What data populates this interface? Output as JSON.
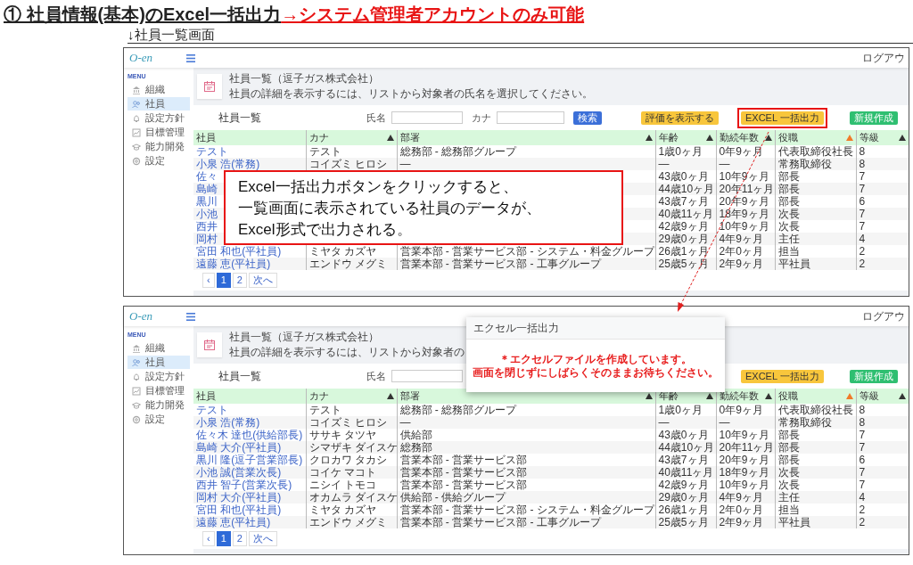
{
  "heading": {
    "text": "① 社員情報(基本)のExcel一括出力",
    "note": "→システム管理者アカウントのみ可能"
  },
  "caption": "↓社員一覧画面",
  "screens": [
    {
      "logo": "O-en",
      "logout": "ログアウ",
      "menu_label": "MENU",
      "nav": [
        {
          "label": "組織",
          "selected": false
        },
        {
          "label": "社員",
          "selected": true
        },
        {
          "label": "設定方針",
          "selected": false
        },
        {
          "label": "目標管理",
          "selected": false
        },
        {
          "label": "能力開発",
          "selected": false
        },
        {
          "label": "設定",
          "selected": false
        }
      ],
      "page_title": "社員一覧（逗子ガス株式会社）",
      "page_subtitle": "社員の詳細を表示するには、リストから対象者の氏名を選択してください。",
      "list_title": "社員一覧",
      "fields": [
        {
          "kind": "name",
          "label": "氏名"
        },
        {
          "kind": "kana",
          "label": "カナ"
        }
      ],
      "buttons": [
        {
          "kind": "search",
          "label": "検索",
          "highlighted": false
        },
        {
          "kind": "eval",
          "label": "評価を表示する",
          "highlighted": false
        },
        {
          "kind": "excel",
          "label": "EXCEL 一括出力",
          "highlighted": true
        },
        {
          "kind": "new",
          "label": "新規作成",
          "highlighted": false
        }
      ],
      "columns": [
        {
          "label": "社員",
          "sortable": false,
          "sorted": false
        },
        {
          "label": "カナ",
          "sortable": true,
          "sorted": false
        },
        {
          "label": "部署",
          "sortable": true,
          "sorted": false
        },
        {
          "label": "年齢",
          "sortable": true,
          "sorted": false
        },
        {
          "label": "勤続年数",
          "sortable": true,
          "sorted": false
        },
        {
          "label": "役職",
          "sortable": true,
          "sorted": true
        },
        {
          "label": "等級",
          "sortable": true,
          "sorted": false
        }
      ],
      "rows": [
        {
          "cells": [
            "テスト",
            "テスト",
            "総務部 - 総務部グループ",
            "1歳0ヶ月",
            "0年9ヶ月",
            "代表取締役社長",
            "8"
          ]
        },
        {
          "cells": [
            "小泉 浩(常務)",
            "コイズミ ヒロシ",
            "—",
            "—",
            "—",
            "常務取締役",
            "8"
          ]
        },
        {
          "cells": [
            "佐々",
            null,
            null,
            "43歳0ヶ月",
            "10年9ヶ月",
            "部長",
            "7"
          ]
        },
        {
          "cells": [
            "島崎",
            null,
            null,
            "44歳10ヶ月",
            "20年11ヶ月",
            "部長",
            "7"
          ]
        },
        {
          "cells": [
            "黒川",
            null,
            null,
            "43歳7ヶ月",
            "20年9ヶ月",
            "部長",
            "6"
          ]
        },
        {
          "cells": [
            "小池",
            null,
            null,
            "40歳11ヶ月",
            "18年9ヶ月",
            "次長",
            "7"
          ]
        },
        {
          "cells": [
            "西井",
            null,
            null,
            "42歳9ヶ月",
            "10年9ヶ月",
            "次長",
            "7"
          ]
        },
        {
          "cells": [
            "岡村",
            null,
            null,
            "29歳0ヶ月",
            "4年9ヶ月",
            "主任",
            "4"
          ]
        },
        {
          "cells": [
            "宮田 和也(平社員)",
            "ミヤタ カズヤ",
            "営業本部 - 営業サービス部 - システム・料金グループ",
            "26歳1ヶ月",
            "2年0ヶ月",
            "担当",
            "2"
          ]
        },
        {
          "cells": [
            "遠藤 恵(平社員)",
            "エンドウ メグミ",
            "営業本部 - 営業サービス部 - 工事グループ",
            "25歳5ヶ月",
            "2年9ヶ月",
            "平社員",
            "2"
          ]
        }
      ],
      "pages": [
        {
          "label": "‹",
          "selected": false
        },
        {
          "label": "1",
          "selected": true
        },
        {
          "label": "2",
          "selected": false
        },
        {
          "label": "次へ",
          "selected": false
        }
      ],
      "callout": {
        "lines": [
          "Excel一括出力ボタンをクリックすると、",
          "一覧画面に表示されている社員のデータが、",
          "Excel形式で出力される。"
        ]
      }
    },
    {
      "logo": "O-en",
      "logout": "ログアウ",
      "menu_label": "MENU",
      "nav": [
        {
          "label": "組織",
          "selected": false
        },
        {
          "label": "社員",
          "selected": true
        },
        {
          "label": "設定方針",
          "selected": false
        },
        {
          "label": "目標管理",
          "selected": false
        },
        {
          "label": "能力開発",
          "selected": false
        },
        {
          "label": "設定",
          "selected": false
        }
      ],
      "page_title": "社員一覧（逗子ガス株式会社）",
      "page_subtitle": "社員の詳細を表示するには、リストから対象者の",
      "list_title": "社員一覧",
      "fields": [
        {
          "kind": "name",
          "label": "氏名"
        }
      ],
      "buttons": [
        {
          "kind": "excel",
          "label": "EXCEL 一括出力",
          "highlighted": false
        },
        {
          "kind": "new",
          "label": "新規作成",
          "highlighted": false
        }
      ],
      "columns": [
        {
          "label": "社員",
          "sortable": false,
          "sorted": false
        },
        {
          "label": "カナ",
          "sortable": true,
          "sorted": false
        },
        {
          "label": "部署",
          "sortable": true,
          "sorted": false
        },
        {
          "label": "年齢",
          "sortable": true,
          "sorted": false
        },
        {
          "label": "勤続年数",
          "sortable": true,
          "sorted": false
        },
        {
          "label": "役職",
          "sortable": true,
          "sorted": true
        },
        {
          "label": "等級",
          "sortable": true,
          "sorted": false
        }
      ],
      "rows": [
        {
          "cells": [
            "テスト",
            "テスト",
            "総務部 - 総務部グループ",
            "1歳0ヶ月",
            "0年9ヶ月",
            "代表取締役社長",
            "8"
          ]
        },
        {
          "cells": [
            "小泉 浩(常務)",
            "コイズミ ヒロシ",
            "—",
            "—",
            "—",
            "常務取締役",
            "8"
          ]
        },
        {
          "cells": [
            "佐々木 達也(供給部長)",
            "ササキ タツヤ",
            "供給部",
            "43歳0ヶ月",
            "10年9ヶ月",
            "部長",
            "7"
          ]
        },
        {
          "cells": [
            "島崎 大介(平社員)",
            "シマザキ ダイスケ",
            "総務部",
            "44歳10ヶ月",
            "20年11ヶ月",
            "部長",
            "7"
          ]
        },
        {
          "cells": [
            "黒川 隆(逗子営業部長)",
            "クロカワ タカシ",
            "営業本部 - 営業サービス部",
            "43歳7ヶ月",
            "20年9ヶ月",
            "部長",
            "6"
          ]
        },
        {
          "cells": [
            "小池 誠(営業次長)",
            "コイケ マコト",
            "営業本部 - 営業サービス部",
            "40歳11ヶ月",
            "18年9ヶ月",
            "次長",
            "7"
          ]
        },
        {
          "cells": [
            "西井 智子(営業次長)",
            "ニシイ トモコ",
            "営業本部 - 営業サービス部",
            "42歳9ヶ月",
            "10年9ヶ月",
            "次長",
            "7"
          ]
        },
        {
          "cells": [
            "岡村 大介(平社員)",
            "オカムラ ダイスケ",
            "供給部 - 供給グループ",
            "29歳0ヶ月",
            "4年9ヶ月",
            "主任",
            "4"
          ]
        },
        {
          "cells": [
            "宮田 和也(平社員)",
            "ミヤタ カズヤ",
            "営業本部 - 営業サービス部 - システム・料金グループ",
            "26歳1ヶ月",
            "2年0ヶ月",
            "担当",
            "2"
          ]
        },
        {
          "cells": [
            "遠藤 恵(平社員)",
            "エンドウ メグミ",
            "営業本部 - 営業サービス部 - 工事グループ",
            "25歳5ヶ月",
            "2年9ヶ月",
            "平社員",
            "2"
          ]
        }
      ],
      "pages": [
        {
          "label": "‹",
          "selected": false
        },
        {
          "label": "1",
          "selected": true
        },
        {
          "label": "2",
          "selected": false
        },
        {
          "label": "次へ",
          "selected": false
        }
      ],
      "modal": {
        "title": "エクセル一括出力",
        "lines": [
          "＊エクセルファイルを作成しています。",
          "画面を閉じずにしばらくそのままお待ちください。"
        ]
      }
    }
  ]
}
